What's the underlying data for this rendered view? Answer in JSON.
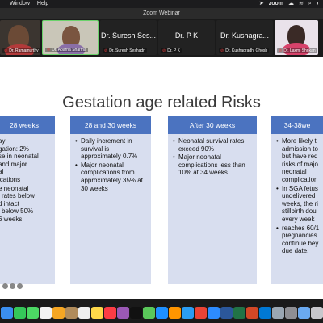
{
  "menubar": {
    "items": [
      "Window",
      "Help"
    ],
    "app_name": "zoom"
  },
  "window": {
    "title": "Zoom Webinar"
  },
  "participants": [
    {
      "name_label": "Dr. Ramamurthy",
      "big_name": ""
    },
    {
      "name_label": "Dr. Aparna Sharma",
      "big_name": ""
    },
    {
      "name_label": "Dr. Suresh Seshadri",
      "big_name": "Dr. Suresh Ses..."
    },
    {
      "name_label": "Dr. P K",
      "big_name": "Dr. P K"
    },
    {
      "name_label": "Dr. Kushagradhi Ghosh",
      "big_name": "Dr. Kushagra..."
    },
    {
      "name_label": "Dr. Laxmi Shrikan",
      "big_name": ""
    }
  ],
  "slide": {
    "title": "Gestation age related Risks",
    "columns": [
      {
        "header": "28 weeks",
        "bullets": [
          "ay\ngation: 2%\nse in neonatal\nand  major\nal\nications",
          "e neonatal\nl rates below\nd intact\nl below 50%\n6 weeks"
        ]
      },
      {
        "header": "28 and 30 weeks",
        "bullets": [
          "Daily increment in survival is approximately 0.7%",
          "Major neonatal complications from approximately 35% at 30 weeks"
        ]
      },
      {
        "header": "After 30 weeks",
        "bullets": [
          "Neonatal survival rates exceed 90%",
          "Major neonatal complications less than 10% at 34 weeks"
        ]
      },
      {
        "header": "34-38we",
        "bullets": [
          "More likely t\nadmission to\nbut have red\nrisks of majo\nneonatal\ncomplication",
          "In SGA fetus\nundelivered\nweeks, the ri\nstillbirth dou\nevery week",
          "reaches 60/1\npregnancies\ncontinue bey\ndue date."
        ]
      }
    ]
  },
  "colors": {
    "header_blue": "#4b73c0",
    "column_fill": "#d8deef",
    "active_speaker_border": "#6bd26b"
  }
}
